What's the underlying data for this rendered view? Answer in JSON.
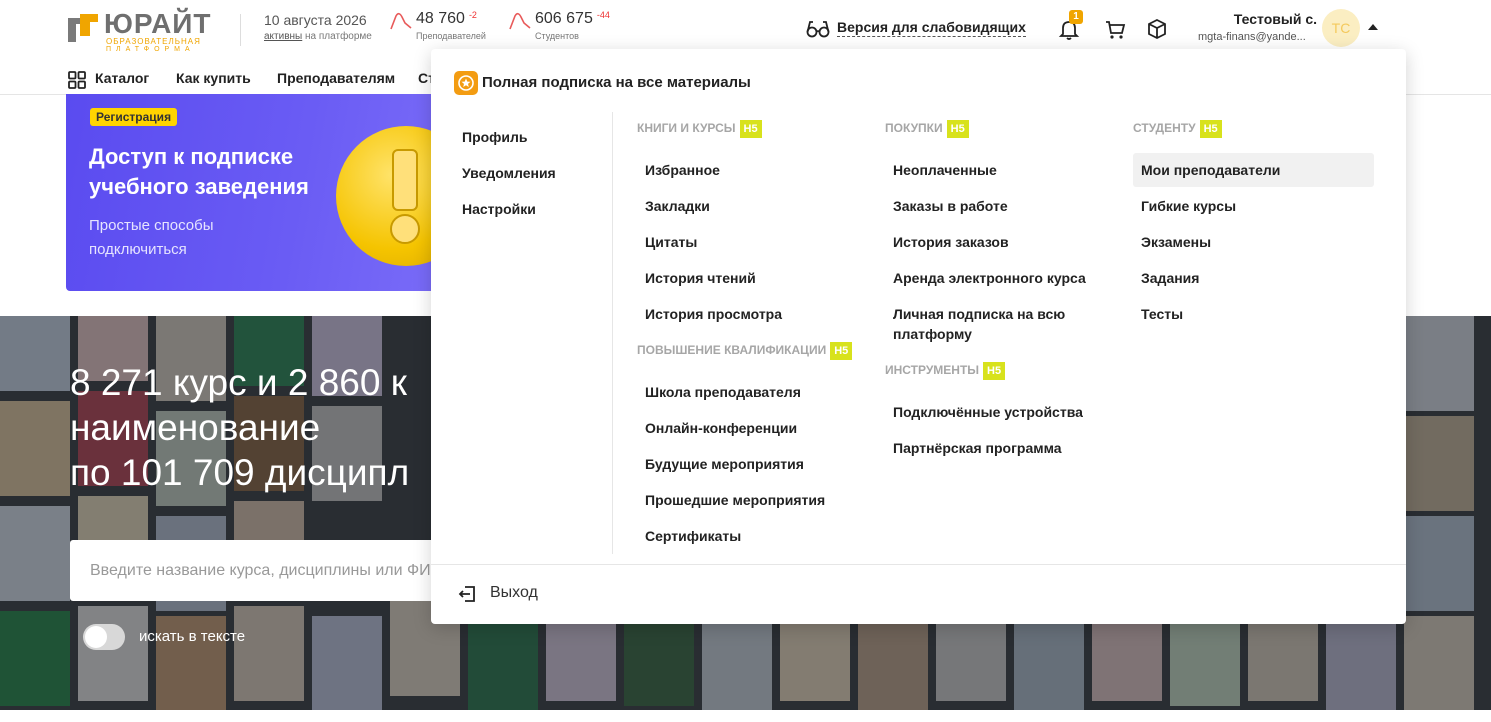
{
  "header": {
    "logo": {
      "title": "ЮРАЙТ",
      "subtitle1": "ОБРАЗОВАТЕЛЬНАЯ",
      "subtitle2": "ПЛАТФОРМА"
    },
    "date": "10 августа 2026",
    "active_link": "активны",
    "active_suffix": "на платформе",
    "teachers": {
      "count": "48 760",
      "delta": "-2",
      "label": "Преподавателей"
    },
    "students": {
      "count": "606 675",
      "delta": "-44",
      "label": "Студентов"
    },
    "accessibility_label": "Версия для слабовидящих",
    "notifications_count": "1",
    "user": {
      "name": "Тестовый с.",
      "email": "mgta-finans@yande...",
      "initials": "ТС"
    }
  },
  "nav": {
    "catalog": "Каталог",
    "how_to_buy": "Как купить",
    "teachers": "Преподавателям",
    "students_partial": "Ст"
  },
  "promo": {
    "tag": "Регистрация",
    "title": "Доступ к подписке учебного заведения",
    "subtitle": "Простые способы подключиться"
  },
  "hero": {
    "line1": "8 271 курс и 2 860 к",
    "line2": "наименование",
    "line3": "по 101 709 дисципл",
    "search_placeholder": "Введите название курса, дисциплины или ФИ",
    "search_in_text_label": "искать в тексте"
  },
  "dropdown": {
    "header": "Полная подписка на все материалы",
    "profile_menu": [
      "Профиль",
      "Уведомления",
      "Настройки"
    ],
    "books_courses": {
      "title": "КНИГИ И КУРСЫ",
      "badge": "Н5",
      "items": [
        "Избранное",
        "Закладки",
        "Цитаты",
        "История чтений",
        "История просмотра"
      ]
    },
    "qualification": {
      "title": "ПОВЫШЕНИЕ КВАЛИФИКАЦИИ",
      "badge": "Н5",
      "items": [
        "Школа преподавателя",
        "Онлайн-конференции",
        "Будущие мероприятия",
        "Прошедшие мероприятия",
        "Сертификаты"
      ]
    },
    "purchases": {
      "title": "ПОКУПКИ",
      "badge": "Н5",
      "items": [
        "Неоплаченные",
        "Заказы в работе",
        "История заказов",
        "Аренда электронного курса",
        "Личная подписка на всю платформу"
      ]
    },
    "tools": {
      "title": "ИНСТРУМЕНТЫ",
      "badge": "Н5",
      "items": [
        "Подключённые устройства",
        "Партнёрская программа"
      ]
    },
    "student": {
      "title": "СТУДЕНТУ",
      "badge": "Н5",
      "items": [
        "Мои преподаватели",
        "Гибкие курсы",
        "Экзамены",
        "Задания",
        "Тесты"
      ]
    },
    "logout": "Выход"
  },
  "colors": {
    "accent": "#f39c12",
    "badge_h5": "#d8e21c",
    "promo": "#5a4bf0",
    "delta": "#e33333"
  },
  "icons": [
    "glasses-icon",
    "bell-icon",
    "cart-icon",
    "box-icon",
    "grid-icon",
    "logout-icon",
    "star-icon"
  ]
}
